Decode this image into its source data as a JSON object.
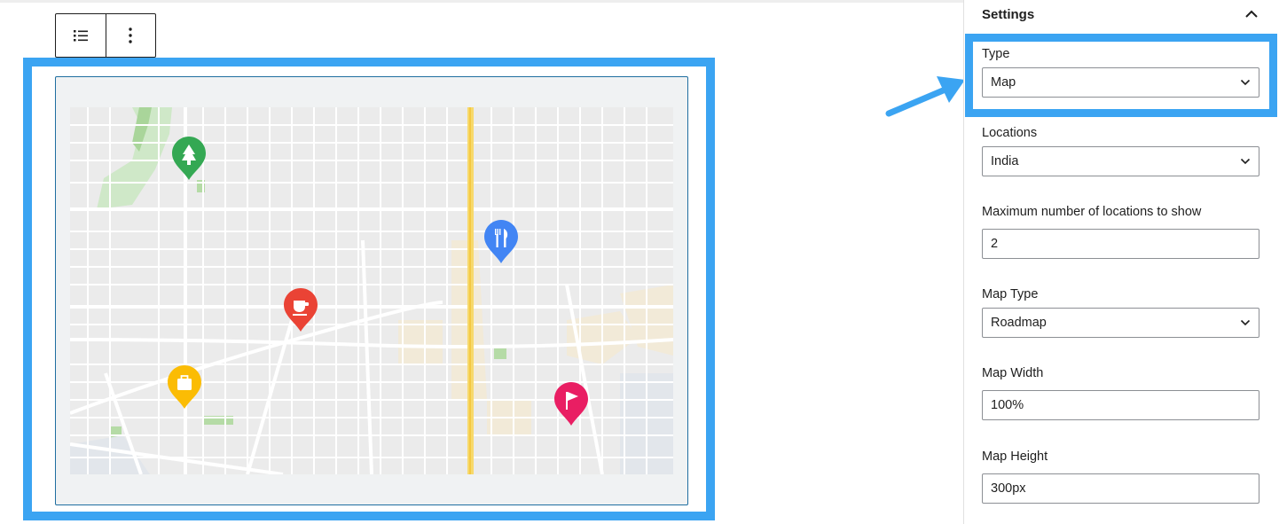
{
  "toolbar": {
    "list_icon": "list-view-icon",
    "more_icon": "more-vertical-icon"
  },
  "map": {
    "markers": [
      {
        "icon": "tree-icon",
        "color": "#34a853"
      },
      {
        "icon": "restaurant-icon",
        "color": "#4285f4"
      },
      {
        "icon": "cafe-icon",
        "color": "#ea4335"
      },
      {
        "icon": "shopping-bag-icon",
        "color": "#fbbc04"
      },
      {
        "icon": "flag-icon",
        "color": "#e91e63"
      }
    ]
  },
  "sidebar": {
    "title": "Settings",
    "collapse_icon": "chevron-up-icon",
    "fields": {
      "type": {
        "label": "Type",
        "value": "Map"
      },
      "locations": {
        "label": "Locations",
        "value": "India"
      },
      "max_locations": {
        "label": "Maximum number of locations to show",
        "value": "2"
      },
      "map_type": {
        "label": "Map Type",
        "value": "Roadmap"
      },
      "map_width": {
        "label": "Map Width",
        "value": "100%"
      },
      "map_height": {
        "label": "Map Height",
        "value": "300px"
      }
    }
  },
  "colors": {
    "highlight": "#3ba4f2",
    "frame_border": "#1f6ea0",
    "road_yellow": "#f7d96b"
  }
}
